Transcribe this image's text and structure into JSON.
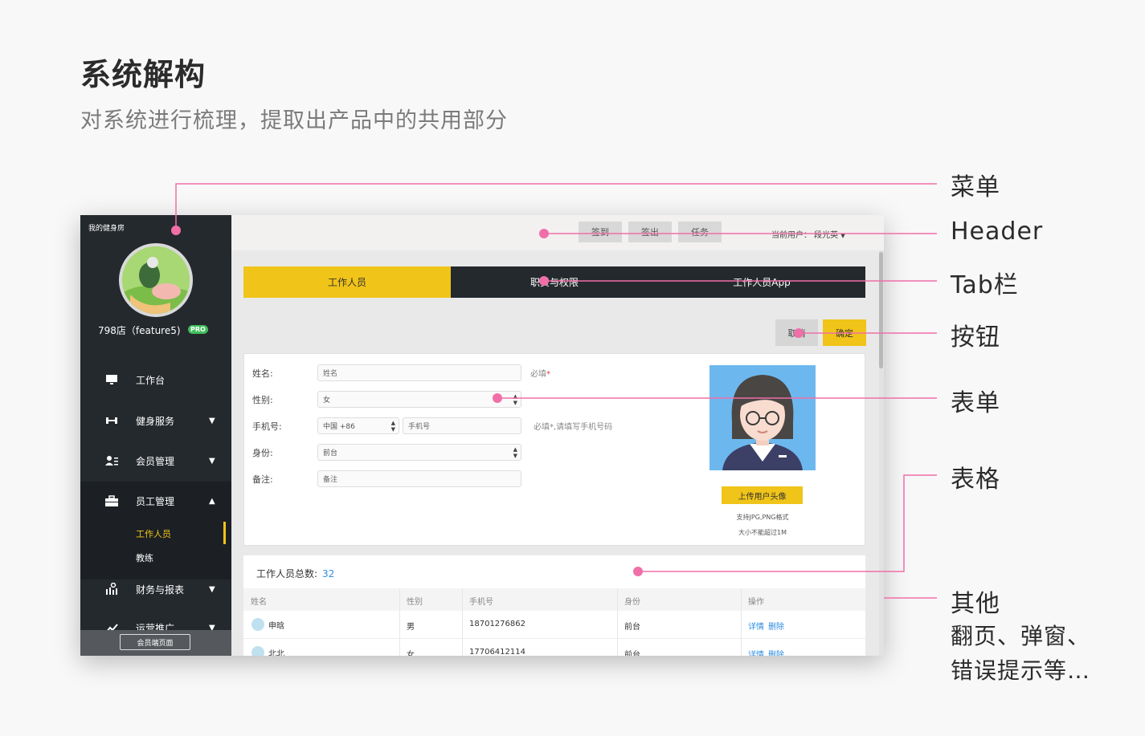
{
  "slide": {
    "title": "系统解构",
    "subtitle": "对系统进行梳理，提取出产品中的共用部分"
  },
  "callouts": {
    "menu": "菜单",
    "header": "Header",
    "tabbar": "Tab栏",
    "button": "按钮",
    "form": "表单",
    "table": "表格",
    "other": "其他",
    "other_line2": "翻页、弹窗、",
    "other_line3": "错误提示等…"
  },
  "accent_color": "#f06fa8",
  "app": {
    "store_title": "我的健身房",
    "shop_name": "798店（feature5)",
    "pro_badge": "PRO",
    "nav": [
      {
        "label": "工作台",
        "icon": "monitor-icon"
      },
      {
        "label": "健身服务",
        "icon": "dumbbell-icon"
      },
      {
        "label": "会员管理",
        "icon": "members-icon"
      },
      {
        "label": "员工管理",
        "icon": "briefcase-icon"
      },
      {
        "label": "财务与报表",
        "icon": "report-icon"
      },
      {
        "label": "运营推广",
        "icon": "chart-icon"
      }
    ],
    "sub_nav": [
      "工作人员",
      "教练"
    ],
    "member_button": "会员端页面",
    "header_buttons": [
      "签到",
      "签出",
      "任务"
    ],
    "current_user": "当前用户：  段光英",
    "tabs": [
      "工作人员",
      "职责与权限",
      "工作人员App"
    ],
    "cancel_button": "取消",
    "confirm_button": "确定",
    "form": {
      "name_label": "姓名:",
      "name_placeholder": "姓名",
      "required_text": "必填",
      "gender_label": "性别:",
      "gender_value": "女",
      "phone_label": "手机号:",
      "country_code": "中国 +86",
      "phone_placeholder": "手机号",
      "phone_hint": "必填*,请填写手机号码",
      "identity_label": "身份:",
      "identity_value": "前台",
      "remark_label": "备注:",
      "remark_placeholder": "备注",
      "upload_button": "上传用户头像",
      "format_note": "支持JPG,PNG格式",
      "size_note": "大小不能超过1M"
    },
    "table": {
      "total_label": "工作人员总数:",
      "total_count": "32",
      "headers": [
        "姓名",
        "性别",
        "手机号",
        "身份",
        "操作"
      ],
      "rows": [
        {
          "name": "申晗",
          "gender": "男",
          "phone": "18701276862",
          "role": "前台",
          "detail": "详情",
          "delete": "删除"
        },
        {
          "name": "北北",
          "gender": "女",
          "phone": "17706412114",
          "role": "前台",
          "detail": "详情",
          "delete": "删除"
        }
      ]
    }
  }
}
